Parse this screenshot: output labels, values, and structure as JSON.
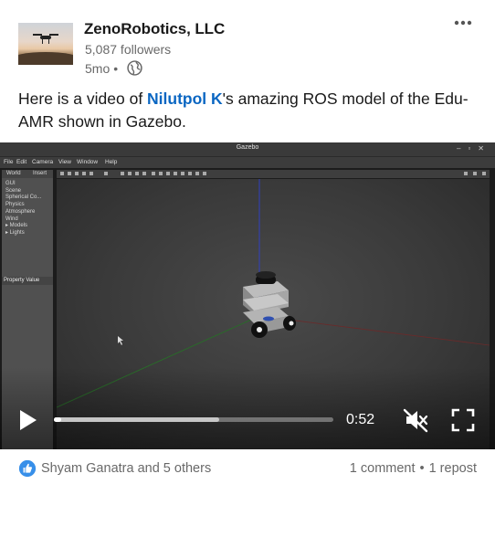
{
  "author": {
    "name": "ZenoRobotics, LLC",
    "followers": "5,087 followers",
    "time_ago": "5mo",
    "separator": "•",
    "visibility_icon": "globe-icon",
    "more_icon": "more-horizontal-icon"
  },
  "post": {
    "text_before": "Here is a video of ",
    "mention": "Nilutpol K",
    "text_after": "'s amazing ROS model of the Edu-AMR shown in Gazebo."
  },
  "video": {
    "window_title": "Gazebo",
    "menu": [
      "File",
      "Edit",
      "Camera",
      "View",
      "Window",
      "Help"
    ],
    "tabs": [
      "World",
      "Insert"
    ],
    "tree": [
      "GUI",
      "Scene",
      "Spherical Co...",
      "Physics",
      "Atmosphere",
      "Wind",
      "▸ Models",
      "▸ Lights"
    ],
    "property_header": "Property Value",
    "time_remaining": "0:52",
    "progress_fraction": 0.005,
    "buffered_fraction": 0.59,
    "muted": true
  },
  "footer": {
    "reactions_text": "Shyam Ganatra and 5 others",
    "comments": "1 comment",
    "dot": "•",
    "reposts": "1 repost"
  },
  "colors": {
    "link": "#0a66c2",
    "like_blue": "#378fe9"
  }
}
